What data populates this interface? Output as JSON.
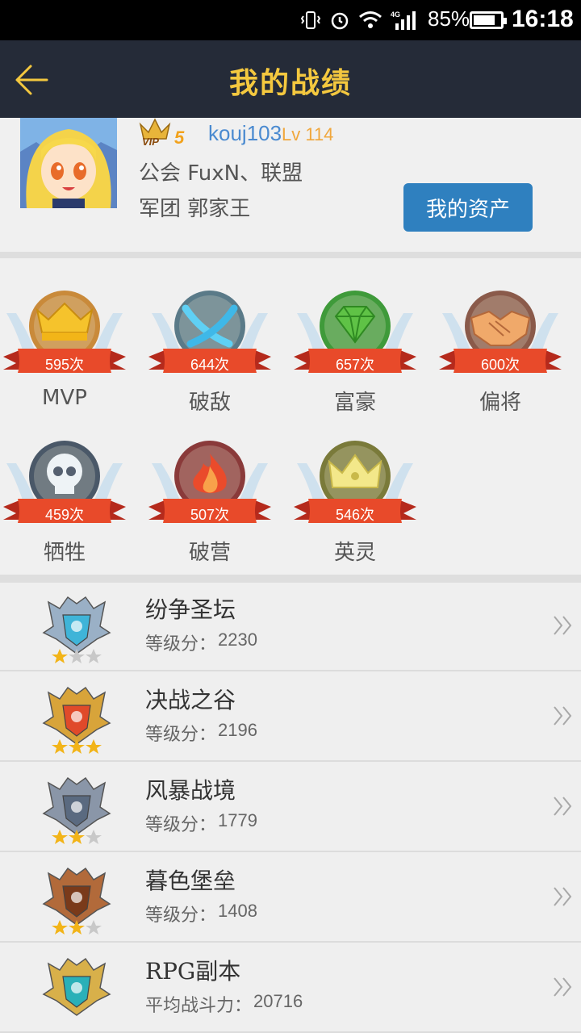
{
  "status_bar": {
    "battery_percent": "85%",
    "time": "16:18",
    "network": "4G",
    "icons": [
      "vibrate-icon",
      "alarm-icon",
      "wifi-icon",
      "signal-icon",
      "battery-icon"
    ]
  },
  "nav": {
    "title": "我的战绩",
    "back_icon": "back-arrow-icon"
  },
  "profile": {
    "vip": "VIP5",
    "username": "kouj103",
    "level": "Lv 114",
    "guild": "公会 FuxN、联盟",
    "legion": "军团 郭家王",
    "assets_button": "我的资产"
  },
  "achievements": [
    {
      "label": "MVP",
      "count": "595次",
      "icon": "crown-icon",
      "color": "#f5c32c"
    },
    {
      "label": "破敌",
      "count": "644次",
      "icon": "crossed-swords-icon",
      "color": "#3fb8e8"
    },
    {
      "label": "富豪",
      "count": "657次",
      "icon": "diamond-icon",
      "color": "#5fc246"
    },
    {
      "label": "偏将",
      "count": "600次",
      "icon": "handshake-icon",
      "color": "#f0a96a"
    },
    {
      "label": "牺牲",
      "count": "459次",
      "icon": "skull-icon",
      "color": "#d8e4ec"
    },
    {
      "label": "破营",
      "count": "507次",
      "icon": "flame-icon",
      "color": "#ea4b2b"
    },
    {
      "label": "英灵",
      "count": "546次",
      "icon": "spirit-crown-icon",
      "color": "#f3e88a"
    }
  ],
  "modes": [
    {
      "name": "纷争圣坛",
      "score_label": "等级分：",
      "score": "2230",
      "stars": 1,
      "badge": "silver-blue"
    },
    {
      "name": "决战之谷",
      "score_label": "等级分：",
      "score": "2196",
      "stars": 3,
      "badge": "gold"
    },
    {
      "name": "风暴战境",
      "score_label": "等级分：",
      "score": "1779",
      "stars": 2,
      "badge": "steel"
    },
    {
      "name": "暮色堡垒",
      "score_label": "等级分：",
      "score": "1408",
      "stars": 2,
      "badge": "bronze"
    },
    {
      "name": "RPG副本",
      "score_label": "平均战斗力：",
      "score": "20716",
      "stars": 0,
      "badge": "gold-teal"
    }
  ]
}
